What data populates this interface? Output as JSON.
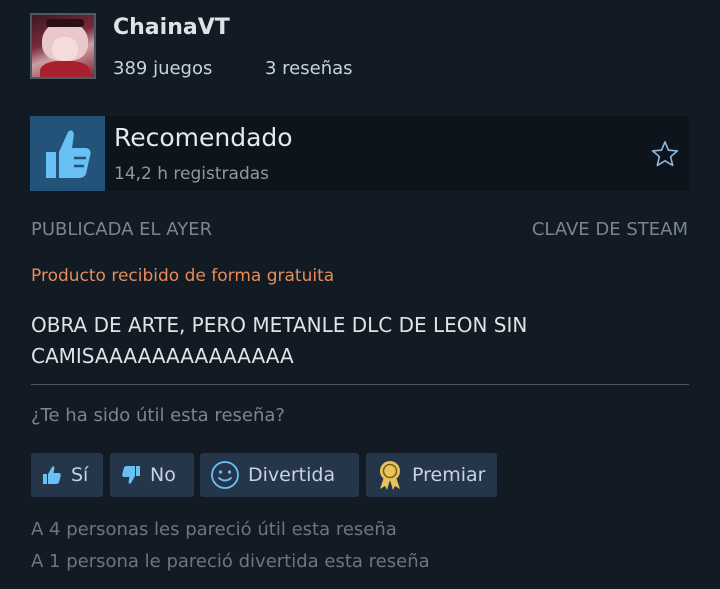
{
  "author": {
    "username": "ChainaVT",
    "games_count": "389 juegos",
    "reviews_count": "3 reseñas",
    "avatar_icon": "anime-character-avatar"
  },
  "review": {
    "verdict": "Recomendado",
    "hours": "14,2 h registradas",
    "verdict_icon": "thumbs-up-icon",
    "posted": "PUBLICADA EL AYER",
    "source": "CLAVE DE STEAM",
    "free_notice": "Producto recibido de forma gratuita",
    "text": "OBRA DE ARTE, PERO METANLE DLC DE LEON SIN CAMISAAAAAAAAAAAAAA"
  },
  "feedback": {
    "question": "¿Te ha sido útil esta reseña?",
    "yes_label": "Sí",
    "no_label": "No",
    "funny_label": "Divertida",
    "award_label": "Premiar"
  },
  "stats": {
    "helpful": "A 4 personas les pareció útil esta reseña",
    "funny": "A 1 persona le pareció divertida esta reseña"
  },
  "colors": {
    "background": "#121a24",
    "recommend_accent": "#24537a",
    "free_notice": "#e68c5a",
    "button_bg": "#26364a",
    "award_gold": "#e8c35a"
  }
}
